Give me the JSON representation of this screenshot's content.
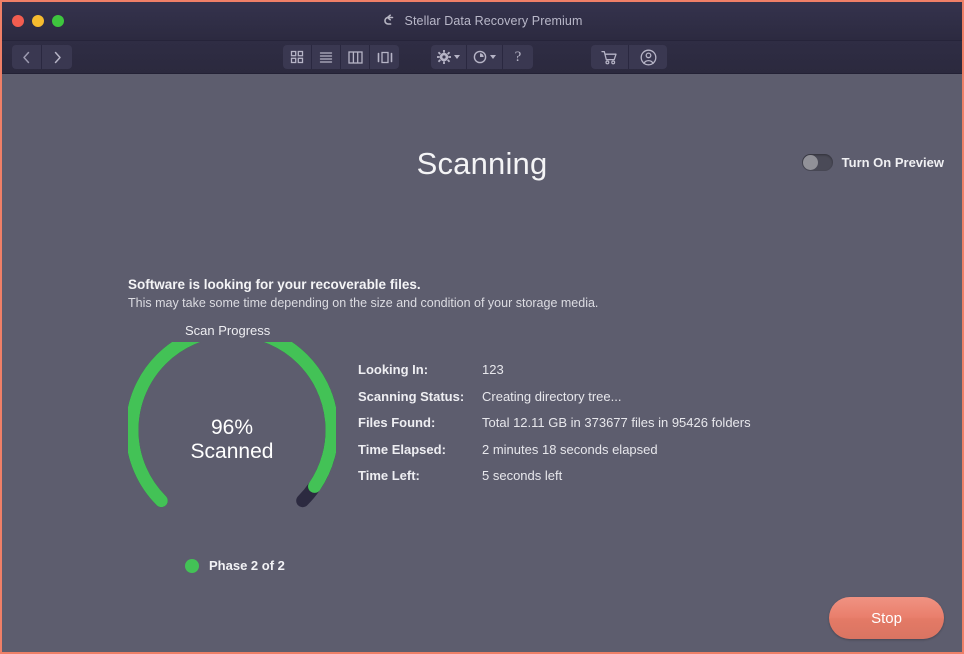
{
  "window": {
    "title": "Stellar Data Recovery Premium",
    "title_icon": "return-arrow-icon",
    "accent_border": "#ef7f67",
    "titlebar_bg": "#302e46",
    "content_bg": "#5d5d6e"
  },
  "traffic_lights": {
    "close": "close-window",
    "minimize": "minimize-window",
    "maximize": "maximize-window"
  },
  "toolbar": {
    "nav": [
      {
        "name": "back-button",
        "icon": "chevron-left-icon"
      },
      {
        "name": "forward-button",
        "icon": "chevron-right-icon"
      }
    ],
    "views": [
      {
        "name": "icon-view-button",
        "icon": "grid-icon"
      },
      {
        "name": "list-view-button",
        "icon": "list-icon"
      },
      {
        "name": "column-view-button",
        "icon": "columns-icon"
      },
      {
        "name": "gallery-view-button",
        "icon": "gallery-icon"
      }
    ],
    "tools": [
      {
        "name": "settings-button",
        "icon": "gear-icon",
        "has_caret": true
      },
      {
        "name": "history-button",
        "icon": "clock-icon",
        "has_caret": true
      },
      {
        "name": "help-button",
        "icon": "question-mark-icon",
        "label": "?"
      }
    ],
    "account": [
      {
        "name": "cart-button",
        "icon": "shopping-cart-icon"
      },
      {
        "name": "account-button",
        "icon": "user-circle-icon"
      }
    ]
  },
  "header": {
    "page_title": "Scanning",
    "preview_toggle_label": "Turn On Preview",
    "preview_toggle_on": false
  },
  "body": {
    "headline": "Software is looking for your recoverable files.",
    "subtext": "This may take some time depending on the size and condition of your storage media.",
    "scan_progress_label": "Scan Progress"
  },
  "gauge": {
    "percent": 96,
    "percent_text": "96%",
    "state_text": "Scanned",
    "track_color": "#2c2a40",
    "fill_color": "#43c256"
  },
  "phase": {
    "label": "Phase 2 of 2",
    "current": 2,
    "total": 2,
    "dot_color": "#43c256"
  },
  "details": [
    {
      "key": "Looking In:",
      "value": "123"
    },
    {
      "key": "Scanning Status:",
      "value": "Creating directory tree..."
    },
    {
      "key": "Files Found:",
      "value": "Total 12.11 GB in 373677 files in 95426 folders"
    },
    {
      "key": "Time Elapsed:",
      "value": "2 minutes 18 seconds elapsed"
    },
    {
      "key": "Time Left:",
      "value": "5 seconds left"
    }
  ],
  "footer": {
    "stop_label": "Stop",
    "stop_color": "#e47a66"
  }
}
